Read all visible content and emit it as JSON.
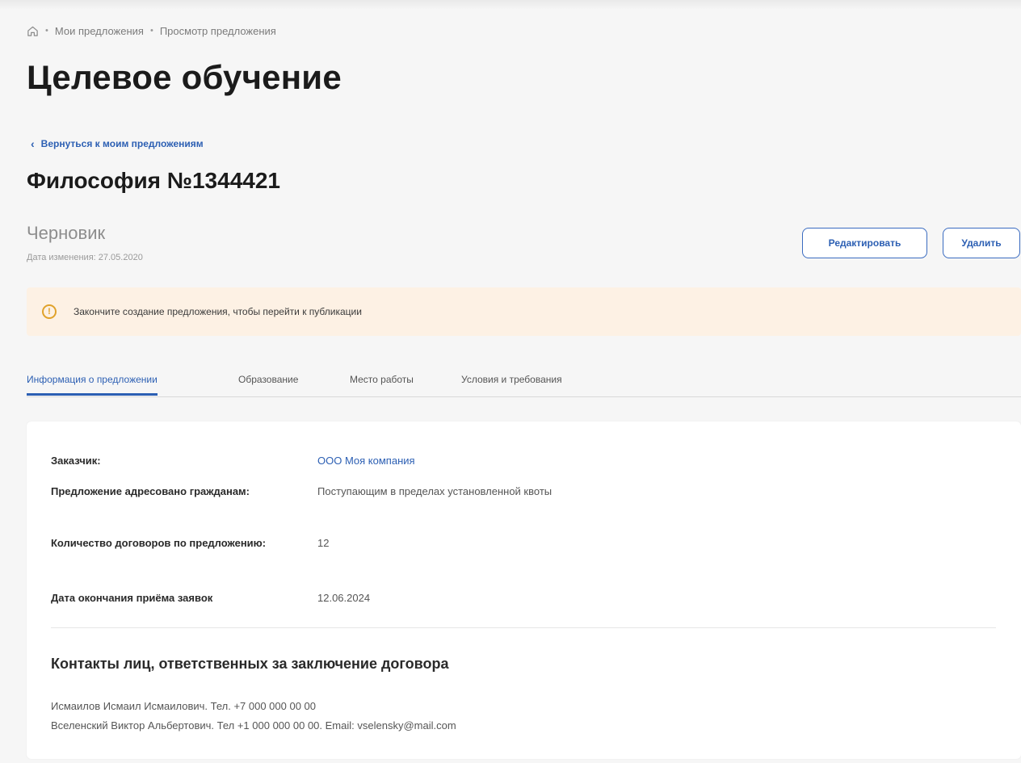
{
  "breadcrumb": {
    "items": [
      "Мои предложения",
      "Просмотр предложения"
    ]
  },
  "page": {
    "title": "Целевое обучение",
    "back_link": "Вернуться к моим предложениям",
    "offer_title": "Философия №1344421",
    "status": "Черновик",
    "modified": "Дата изменения: 27.05.2020"
  },
  "actions": {
    "edit": "Редактировать",
    "delete": "Удалить"
  },
  "alert": {
    "icon": "warning-icon",
    "text": "Закончите создание предложения, чтобы перейти к публикации"
  },
  "tabs": [
    {
      "label": "Информация о предложении",
      "active": true
    },
    {
      "label": "Образование",
      "active": false
    },
    {
      "label": "Место работы",
      "active": false
    },
    {
      "label": "Условия и требования",
      "active": false
    }
  ],
  "info": {
    "rows": [
      {
        "label": "Заказчик:",
        "value": "ООО Моя компания"
      },
      {
        "label": "Предложение адресовано гражданам:",
        "value": "Поступающим в пределах установленной квоты"
      },
      {
        "label": "Количество договоров по предложению:",
        "value": "12"
      },
      {
        "label": "Дата окончания приёма заявок",
        "value": "12.06.2024"
      }
    ]
  },
  "contacts": {
    "title": "Контакты лиц, ответственных за заключение договора",
    "items": [
      "Исмаилов Исмаил Исмаилович. Тел. +7 000 000 00 00",
      "Вселенский Виктор Альбертович. Тел +1 000 000 00 00. Email: vselensky@mail.com"
    ]
  },
  "colors": {
    "accent": "#2c5fb3",
    "alert_bg": "#fdf1e4",
    "warning": "#e0a22b"
  }
}
